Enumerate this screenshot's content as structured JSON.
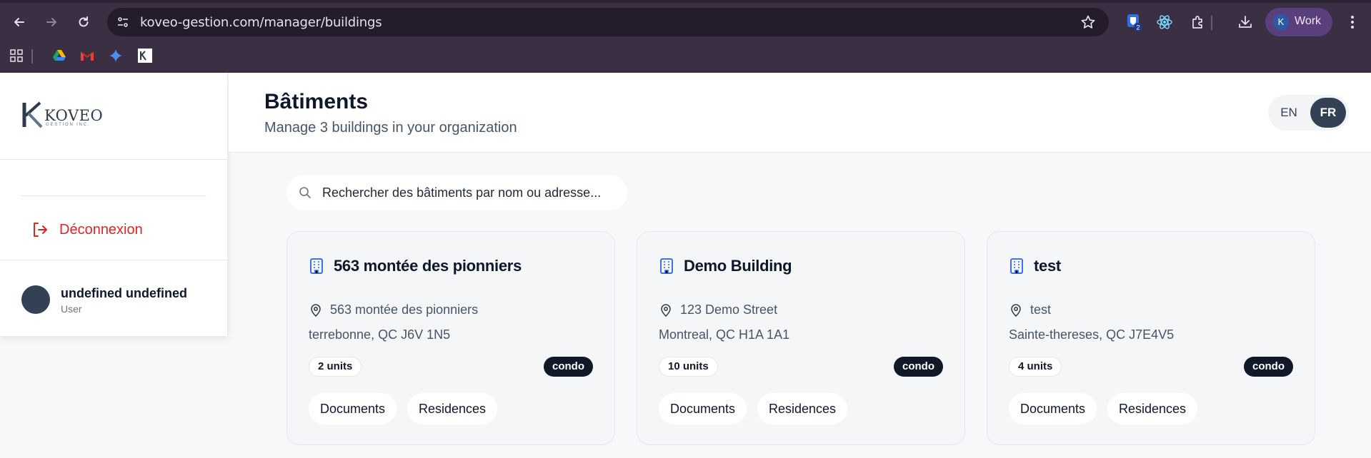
{
  "browser": {
    "url": "koveo-gestion.com/manager/buildings",
    "extension_badge": "2",
    "profile_initial": "K",
    "profile_name": "Work"
  },
  "sidebar": {
    "logo_text": "KOVEO",
    "logo_sub": "GESTION INC.",
    "logout_label": "Déconnexion",
    "user_name": "undefined undefined",
    "user_role": "User"
  },
  "header": {
    "title": "Bâtiments",
    "subtitle": "Manage 3 buildings in your organization",
    "lang_en": "EN",
    "lang_fr": "FR",
    "active_lang": "FR"
  },
  "search": {
    "placeholder": "Rechercher des bâtiments par nom ou adresse..."
  },
  "buildings": [
    {
      "name": "563 montée des pionniers",
      "address": "563 montée des pionniers",
      "city": "terrebonne, QC J6V 1N5",
      "units": "2 units",
      "type": "condo",
      "documents_label": "Documents",
      "residences_label": "Residences"
    },
    {
      "name": "Demo Building",
      "address": "123 Demo Street",
      "city": "Montreal, QC H1A 1A1",
      "units": "10 units",
      "type": "condo",
      "documents_label": "Documents",
      "residences_label": "Residences"
    },
    {
      "name": "test",
      "address": "test",
      "city": "Sainte-thereses, QC J7E4V5",
      "units": "4 units",
      "type": "condo",
      "documents_label": "Documents",
      "residences_label": "Residences"
    }
  ],
  "colors": {
    "accent_blue": "#2563eb",
    "logout_red": "#dc2626",
    "dark_slate": "#334155"
  }
}
